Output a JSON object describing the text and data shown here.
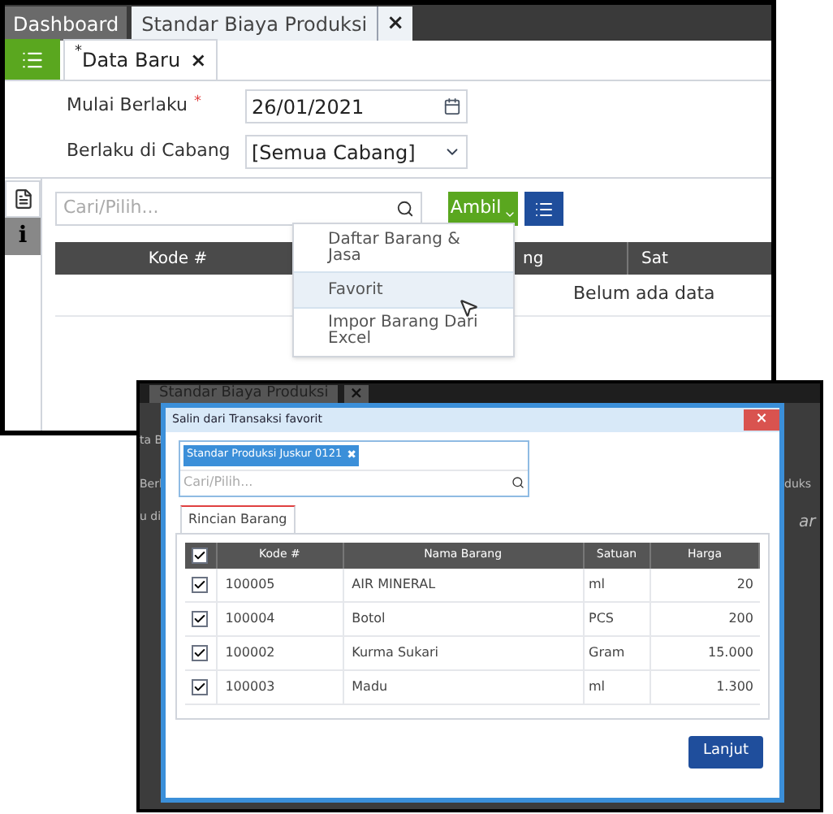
{
  "screenshot_1": {
    "tabs": [
      {
        "label": "Dashboard",
        "selected": false
      },
      {
        "label": "Standar Biaya Produksi",
        "selected": true
      }
    ],
    "tab_close": "×",
    "doc_tab": {
      "modified_mark": "*",
      "label": "Data Baru",
      "close": "×"
    },
    "form": [
      {
        "kind": "date",
        "label": "Mulai Berlaku",
        "required": true,
        "required_mark": "*",
        "value": "26/01/2021"
      },
      {
        "kind": "select",
        "label": "Berlaku di Cabang",
        "required": false,
        "value": "[Semua Cabang]"
      }
    ],
    "side_tabs": [
      {
        "kind": "list",
        "selected": true
      },
      {
        "kind": "info",
        "label": "i",
        "selected": false
      }
    ],
    "search": {
      "placeholder": "Cari/Pilih..."
    },
    "ambil_button": "Ambil",
    "table": {
      "columns": [
        "Kode #",
        "ng",
        "Sat"
      ],
      "empty_message": "Belum ada data"
    },
    "menu": [
      {
        "label": "Daftar Barang & Jasa",
        "selected": false
      },
      {
        "label": "Favorit",
        "selected": true
      },
      {
        "label": "Impor Barang Dari Excel",
        "selected": false
      }
    ]
  },
  "screenshot_2": {
    "background_tab": {
      "label": "Standar Biaya Produksi",
      "close": "×"
    },
    "background_fragments": [
      "ta B",
      "Berl",
      "u di",
      "duks",
      "ar"
    ],
    "dialog": {
      "title": "Salin dari Transaksi favorit",
      "close": "×",
      "tags": [
        {
          "label": "Standar Produksi Juskur 0121",
          "remove": "✖"
        }
      ],
      "search": {
        "placeholder": "Cari/Pilih..."
      },
      "tabs": [
        {
          "label": "Rincian Barang",
          "selected": true
        }
      ],
      "table": {
        "all_checked": true,
        "columns": [
          "Kode #",
          "Nama Barang",
          "Satuan",
          "Harga"
        ],
        "rows": [
          {
            "checked": true,
            "kode": "100005",
            "nama": "AIR MINERAL",
            "satuan": "ml",
            "harga": "20"
          },
          {
            "checked": true,
            "kode": "100004",
            "nama": "Botol",
            "satuan": "PCS",
            "harga": "200"
          },
          {
            "checked": true,
            "kode": "100002",
            "nama": "Kurma Sukari",
            "satuan": "Gram",
            "harga": "15.000"
          },
          {
            "checked": true,
            "kode": "100003",
            "nama": "Madu",
            "satuan": "ml",
            "harga": "1.300"
          }
        ]
      },
      "button": "Lanjut"
    }
  }
}
